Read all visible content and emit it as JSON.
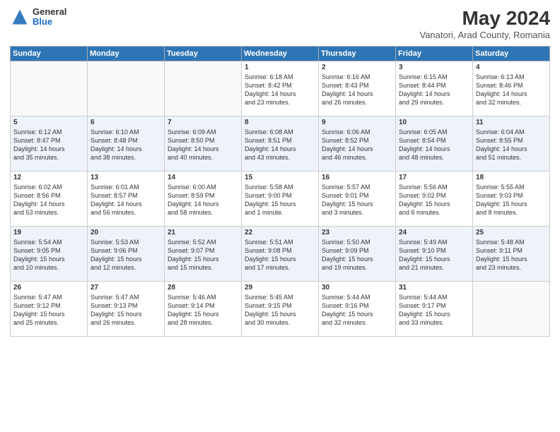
{
  "header": {
    "logo_general": "General",
    "logo_blue": "Blue",
    "title": "May 2024",
    "subtitle": "Vanatori, Arad County, Romania"
  },
  "weekdays": [
    "Sunday",
    "Monday",
    "Tuesday",
    "Wednesday",
    "Thursday",
    "Friday",
    "Saturday"
  ],
  "weeks": [
    [
      {
        "day": "",
        "info": ""
      },
      {
        "day": "",
        "info": ""
      },
      {
        "day": "",
        "info": ""
      },
      {
        "day": "1",
        "info": "Sunrise: 6:18 AM\nSunset: 8:42 PM\nDaylight: 14 hours\nand 23 minutes."
      },
      {
        "day": "2",
        "info": "Sunrise: 6:16 AM\nSunset: 8:43 PM\nDaylight: 14 hours\nand 26 minutes."
      },
      {
        "day": "3",
        "info": "Sunrise: 6:15 AM\nSunset: 8:44 PM\nDaylight: 14 hours\nand 29 minutes."
      },
      {
        "day": "4",
        "info": "Sunrise: 6:13 AM\nSunset: 8:46 PM\nDaylight: 14 hours\nand 32 minutes."
      }
    ],
    [
      {
        "day": "5",
        "info": "Sunrise: 6:12 AM\nSunset: 8:47 PM\nDaylight: 14 hours\nand 35 minutes."
      },
      {
        "day": "6",
        "info": "Sunrise: 6:10 AM\nSunset: 8:48 PM\nDaylight: 14 hours\nand 38 minutes."
      },
      {
        "day": "7",
        "info": "Sunrise: 6:09 AM\nSunset: 8:50 PM\nDaylight: 14 hours\nand 40 minutes."
      },
      {
        "day": "8",
        "info": "Sunrise: 6:08 AM\nSunset: 8:51 PM\nDaylight: 14 hours\nand 43 minutes."
      },
      {
        "day": "9",
        "info": "Sunrise: 6:06 AM\nSunset: 8:52 PM\nDaylight: 14 hours\nand 46 minutes."
      },
      {
        "day": "10",
        "info": "Sunrise: 6:05 AM\nSunset: 8:54 PM\nDaylight: 14 hours\nand 48 minutes."
      },
      {
        "day": "11",
        "info": "Sunrise: 6:04 AM\nSunset: 8:55 PM\nDaylight: 14 hours\nand 51 minutes."
      }
    ],
    [
      {
        "day": "12",
        "info": "Sunrise: 6:02 AM\nSunset: 8:56 PM\nDaylight: 14 hours\nand 53 minutes."
      },
      {
        "day": "13",
        "info": "Sunrise: 6:01 AM\nSunset: 8:57 PM\nDaylight: 14 hours\nand 56 minutes."
      },
      {
        "day": "14",
        "info": "Sunrise: 6:00 AM\nSunset: 8:59 PM\nDaylight: 14 hours\nand 58 minutes."
      },
      {
        "day": "15",
        "info": "Sunrise: 5:58 AM\nSunset: 9:00 PM\nDaylight: 15 hours\nand 1 minute."
      },
      {
        "day": "16",
        "info": "Sunrise: 5:57 AM\nSunset: 9:01 PM\nDaylight: 15 hours\nand 3 minutes."
      },
      {
        "day": "17",
        "info": "Sunrise: 5:56 AM\nSunset: 9:02 PM\nDaylight: 15 hours\nand 6 minutes."
      },
      {
        "day": "18",
        "info": "Sunrise: 5:55 AM\nSunset: 9:03 PM\nDaylight: 15 hours\nand 8 minutes."
      }
    ],
    [
      {
        "day": "19",
        "info": "Sunrise: 5:54 AM\nSunset: 9:05 PM\nDaylight: 15 hours\nand 10 minutes."
      },
      {
        "day": "20",
        "info": "Sunrise: 5:53 AM\nSunset: 9:06 PM\nDaylight: 15 hours\nand 12 minutes."
      },
      {
        "day": "21",
        "info": "Sunrise: 5:52 AM\nSunset: 9:07 PM\nDaylight: 15 hours\nand 15 minutes."
      },
      {
        "day": "22",
        "info": "Sunrise: 5:51 AM\nSunset: 9:08 PM\nDaylight: 15 hours\nand 17 minutes."
      },
      {
        "day": "23",
        "info": "Sunrise: 5:50 AM\nSunset: 9:09 PM\nDaylight: 15 hours\nand 19 minutes."
      },
      {
        "day": "24",
        "info": "Sunrise: 5:49 AM\nSunset: 9:10 PM\nDaylight: 15 hours\nand 21 minutes."
      },
      {
        "day": "25",
        "info": "Sunrise: 5:48 AM\nSunset: 9:11 PM\nDaylight: 15 hours\nand 23 minutes."
      }
    ],
    [
      {
        "day": "26",
        "info": "Sunrise: 5:47 AM\nSunset: 9:12 PM\nDaylight: 15 hours\nand 25 minutes."
      },
      {
        "day": "27",
        "info": "Sunrise: 5:47 AM\nSunset: 9:13 PM\nDaylight: 15 hours\nand 26 minutes."
      },
      {
        "day": "28",
        "info": "Sunrise: 5:46 AM\nSunset: 9:14 PM\nDaylight: 15 hours\nand 28 minutes."
      },
      {
        "day": "29",
        "info": "Sunrise: 5:45 AM\nSunset: 9:15 PM\nDaylight: 15 hours\nand 30 minutes."
      },
      {
        "day": "30",
        "info": "Sunrise: 5:44 AM\nSunset: 9:16 PM\nDaylight: 15 hours\nand 32 minutes."
      },
      {
        "day": "31",
        "info": "Sunrise: 5:44 AM\nSunset: 9:17 PM\nDaylight: 15 hours\nand 33 minutes."
      },
      {
        "day": "",
        "info": ""
      }
    ]
  ]
}
